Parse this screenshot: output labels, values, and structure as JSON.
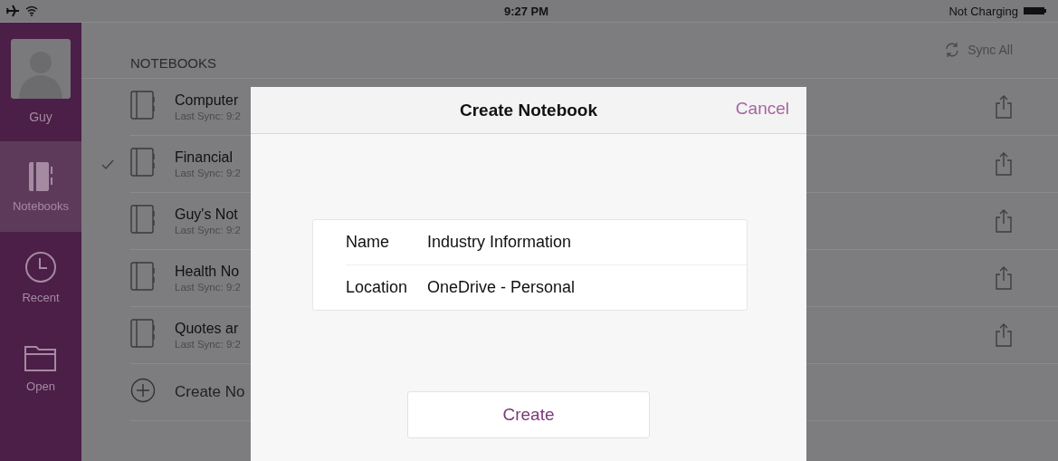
{
  "status_bar": {
    "time": "9:27 PM",
    "battery_text": "Not Charging"
  },
  "sidebar": {
    "profile": {
      "name": "Guy"
    },
    "items": [
      {
        "label": "Notebooks",
        "kind": "notebook",
        "selected": true
      },
      {
        "label": "Recent",
        "kind": "clock",
        "selected": false
      },
      {
        "label": "Open",
        "kind": "folder",
        "selected": false
      }
    ]
  },
  "notebooks": {
    "header": "NOTEBOOKS",
    "sync_all": "Sync All",
    "rows": [
      {
        "name": "Computer",
        "sync": "Last Sync: 9:2",
        "checked": false
      },
      {
        "name": "Financial",
        "sync": "Last Sync: 9:2",
        "checked": true
      },
      {
        "name": "Guy's Not",
        "sync": "Last Sync: 9:2",
        "checked": false
      },
      {
        "name": "Health No",
        "sync": "Last Sync: 9:2",
        "checked": false
      },
      {
        "name": "Quotes ar",
        "sync": "Last Sync: 9:2",
        "checked": false
      }
    ],
    "create": "Create No"
  },
  "dialog": {
    "title": "Create Notebook",
    "cancel": "Cancel",
    "fields": [
      {
        "label": "Name",
        "value": "Industry Information"
      },
      {
        "label": "Location",
        "value": "OneDrive - Personal"
      }
    ],
    "button": "Create"
  }
}
